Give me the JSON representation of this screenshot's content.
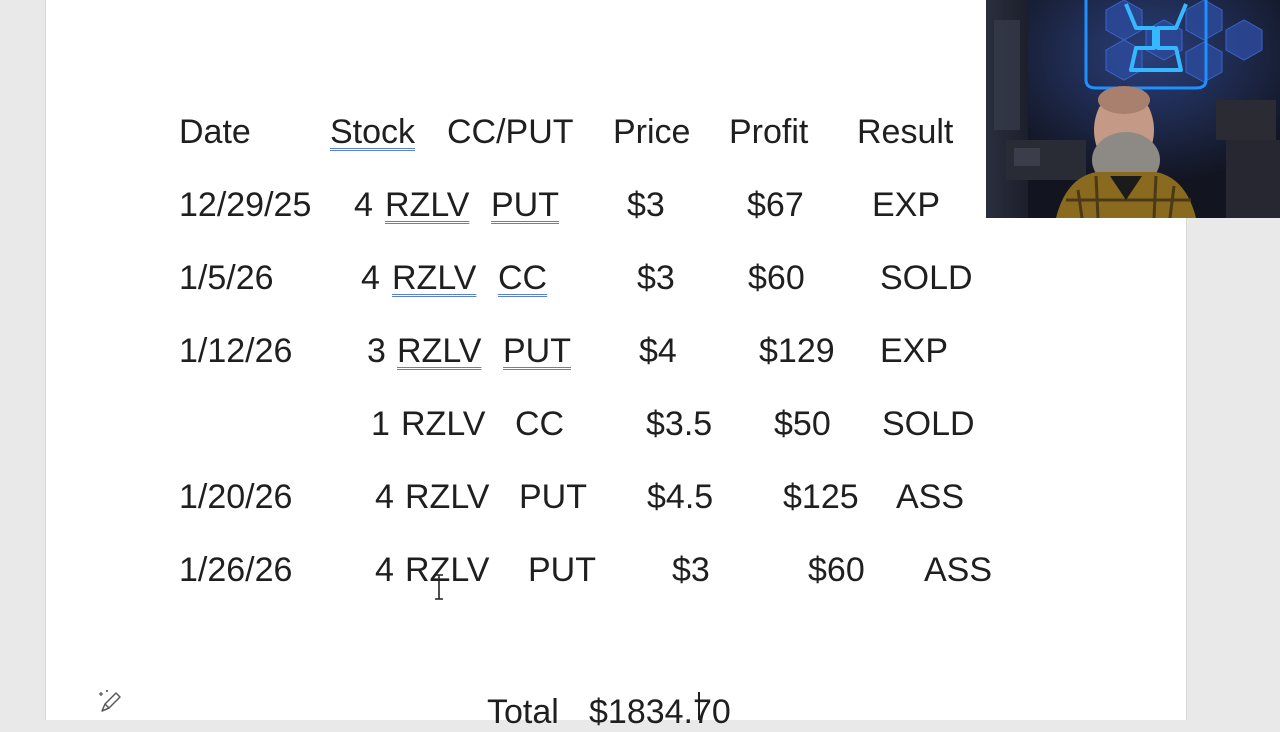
{
  "document": {
    "headers": {
      "date": "Date",
      "stock": "Stock",
      "cc_put": "CC/PUT",
      "price": "Price",
      "profit": "Profit",
      "result": "Result"
    },
    "rows": [
      {
        "date": "12/29/25",
        "qty": "4",
        "stock": "RZLV",
        "type": "PUT",
        "price": "$3",
        "profit": "$67",
        "result": "EXP"
      },
      {
        "date": "1/5/26",
        "qty": "4",
        "stock": "RZLV",
        "type": "CC",
        "price": "$3",
        "profit": "$60",
        "result": "SOLD"
      },
      {
        "date": "1/12/26",
        "qty": "3",
        "stock": "RZLV",
        "type": "PUT",
        "price": "$4",
        "profit": "$129",
        "result": "EXP"
      },
      {
        "date": "",
        "qty": "1",
        "stock": "RZLV",
        "type": "CC",
        "price": "$3.5",
        "profit": "$50",
        "result": "SOLD"
      },
      {
        "date": "1/20/26",
        "qty": "4",
        "stock": "RZLV",
        "type": "PUT",
        "price": "$4.5",
        "profit": "$125",
        "result": "ASS"
      },
      {
        "date": "1/26/26",
        "qty": "4",
        "stock": "RZLV",
        "type": "PUT",
        "price": "$3",
        "profit": "$60",
        "result": "ASS"
      }
    ],
    "total_label": "Total",
    "total_value": "$1834.70"
  },
  "icons": {
    "copilot": "copilot-pen-icon",
    "text_cursor": "ibeam-cursor-icon"
  },
  "colors": {
    "text": "#1f1f1f",
    "underline_accent": "#5b7fd1",
    "webcam_neon": "#1e90ff"
  }
}
